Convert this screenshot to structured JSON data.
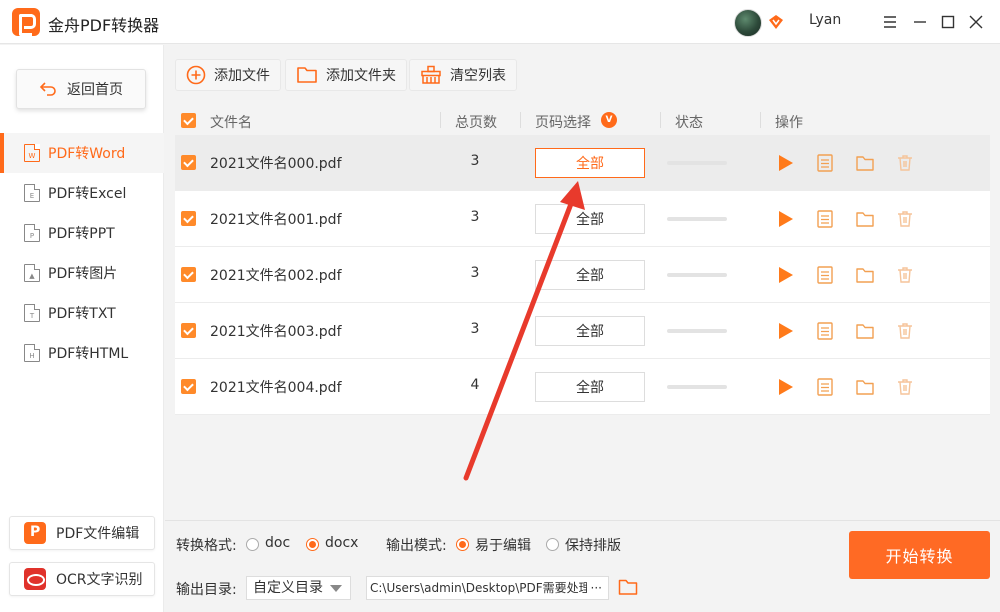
{
  "app": {
    "title": "金舟PDF转换器",
    "user": "Lyan"
  },
  "colors": {
    "accent": "#ff6a1a",
    "button": "#ff6a24",
    "annotation": "#e83a2c"
  },
  "sidebar": {
    "home": "返回首页",
    "items": [
      {
        "label": "PDF转Word",
        "icon": "W",
        "active": true
      },
      {
        "label": "PDF转Excel",
        "icon": "E"
      },
      {
        "label": "PDF转PPT",
        "icon": "P"
      },
      {
        "label": "PDF转图片",
        "icon": "image"
      },
      {
        "label": "PDF转TXT",
        "icon": "T"
      },
      {
        "label": "PDF转HTML",
        "icon": "H"
      }
    ],
    "tools": [
      "PDF文件编辑",
      "OCR文字识别"
    ]
  },
  "toolbar": {
    "add_file": "添加文件",
    "add_folder": "添加文件夹",
    "clear_list": "清空列表"
  },
  "table": {
    "headers": {
      "filename": "文件名",
      "pages": "总页数",
      "range": "页码选择",
      "range_badge": "V",
      "status": "状态",
      "actions": "操作"
    },
    "rows": [
      {
        "name": "2021文件名000.pdf",
        "pages": "3",
        "range": "全部"
      },
      {
        "name": "2021文件名001.pdf",
        "pages": "3",
        "range": "全部"
      },
      {
        "name": "2021文件名002.pdf",
        "pages": "3",
        "range": "全部"
      },
      {
        "name": "2021文件名003.pdf",
        "pages": "3",
        "range": "全部"
      },
      {
        "name": "2021文件名004.pdf",
        "pages": "4",
        "range": "全部"
      }
    ]
  },
  "bottom": {
    "format_label": "转换格式:",
    "format_options": [
      "doc",
      "docx"
    ],
    "format_selected": "docx",
    "mode_label": "输出模式:",
    "mode_options": [
      "易于编辑",
      "保持排版"
    ],
    "mode_selected": "易于编辑",
    "dir_label": "输出目录:",
    "dir_select": "自定义目录",
    "dir_path": "C:\\Users\\admin\\Desktop\\PDF需要处理",
    "dir_more": "···",
    "start": "开始转换"
  }
}
